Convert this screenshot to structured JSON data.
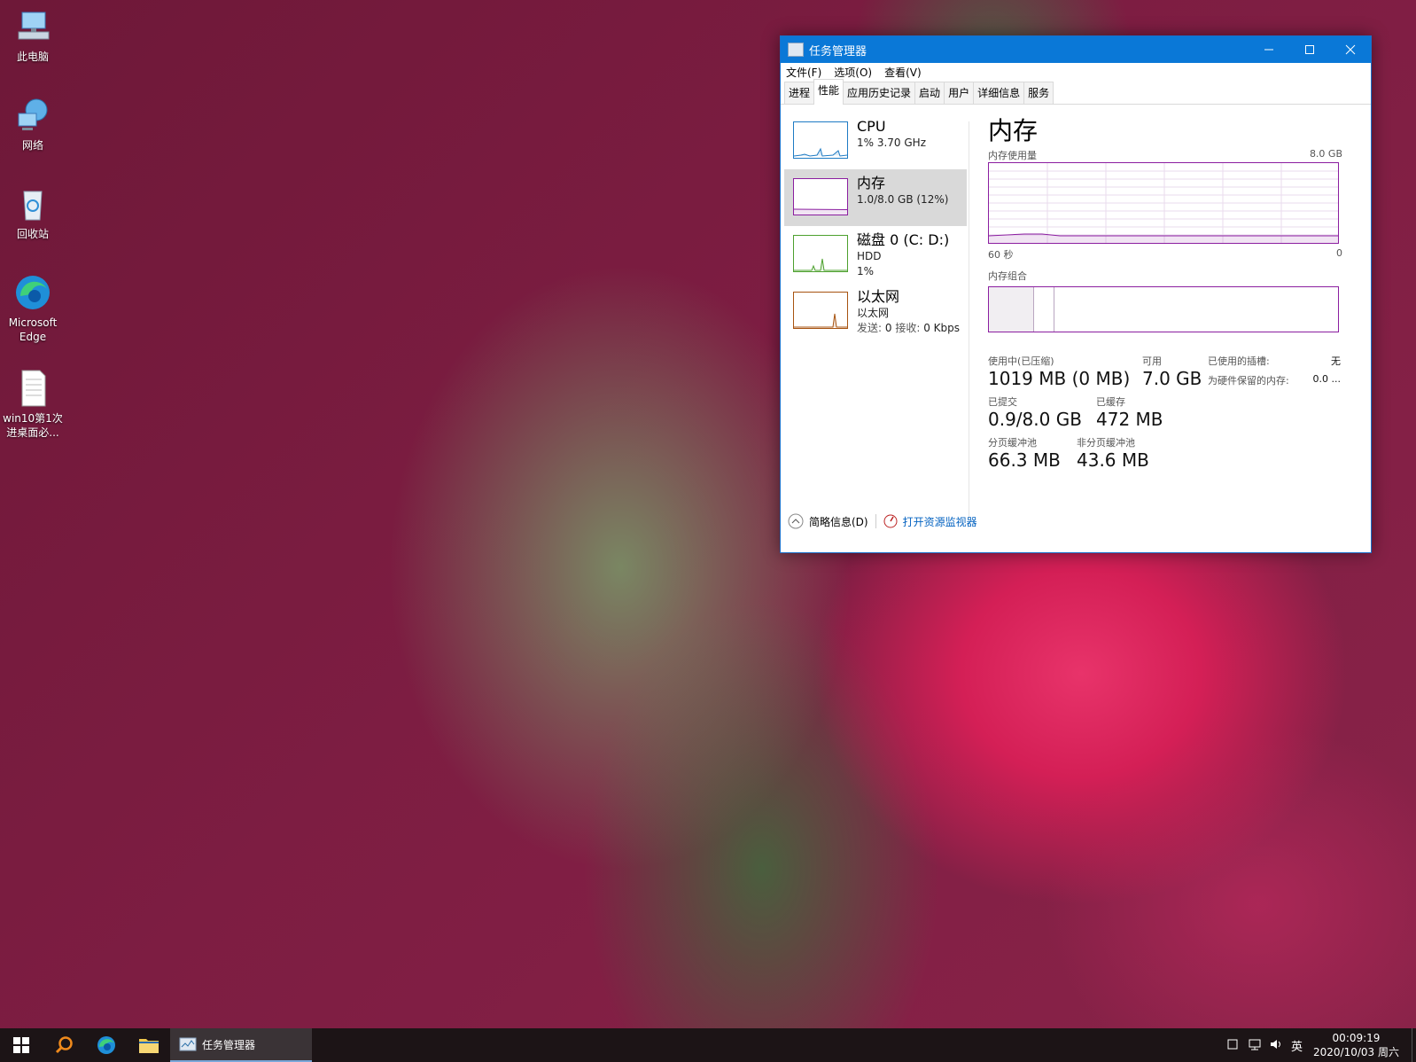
{
  "desktop": {
    "icons": [
      {
        "label": "此电脑"
      },
      {
        "label": "网络"
      },
      {
        "label": "回收站"
      },
      {
        "label": "Microsoft Edge"
      },
      {
        "label": "win10第1次进桌面必..."
      }
    ]
  },
  "window": {
    "title": "任务管理器",
    "menu": [
      "文件(F)",
      "选项(O)",
      "查看(V)"
    ],
    "tabs": [
      "进程",
      "性能",
      "应用历史记录",
      "启动",
      "用户",
      "详细信息",
      "服务"
    ],
    "active_tab": "性能",
    "resources": [
      {
        "name": "CPU",
        "line1": "1% 3.70 GHz",
        "line2": "",
        "color": "#1e7bc4"
      },
      {
        "name": "内存",
        "line1": "1.0/8.0 GB (12%)",
        "line2": "",
        "color": "#8b1ea0"
      },
      {
        "name": "磁盘 0 (C: D:)",
        "line1": "HDD",
        "line2": "1%",
        "color": "#4da02e"
      },
      {
        "name": "以太网",
        "line1": "以太网",
        "line2_a": "发送:",
        "line2_b": "0",
        "line2_c": "接收:",
        "line2_d": "0 Kbps",
        "color": "#a75310"
      }
    ],
    "detail": {
      "title": "内存",
      "usage_label": "内存使用量",
      "usage_max": "8.0 GB",
      "time_left": "60 秒",
      "time_right": "0",
      "composition_label": "内存组合",
      "stats": {
        "in_use_label": "使用中(已压缩)",
        "in_use_value": "1019 MB (0 MB)",
        "available_label": "可用",
        "available_value": "7.0 GB",
        "slots_label": "已使用的插槽:",
        "slots_value": "无",
        "reserved_label": "为硬件保留的内存:",
        "reserved_value": "0.0 ...",
        "committed_label": "已提交",
        "committed_value": "0.9/8.0 GB",
        "cached_label": "已缓存",
        "cached_value": "472 MB",
        "paged_label": "分页缓冲池",
        "paged_value": "66.3 MB",
        "nonpaged_label": "非分页缓冲池",
        "nonpaged_value": "43.6 MB"
      }
    },
    "footer": {
      "brief": "简略信息(D)",
      "monitor": "打开资源监视器"
    }
  },
  "taskbar": {
    "app_label": "任务管理器",
    "ime": "英",
    "time": "00:09:19",
    "date": "2020/10/03 周六"
  }
}
